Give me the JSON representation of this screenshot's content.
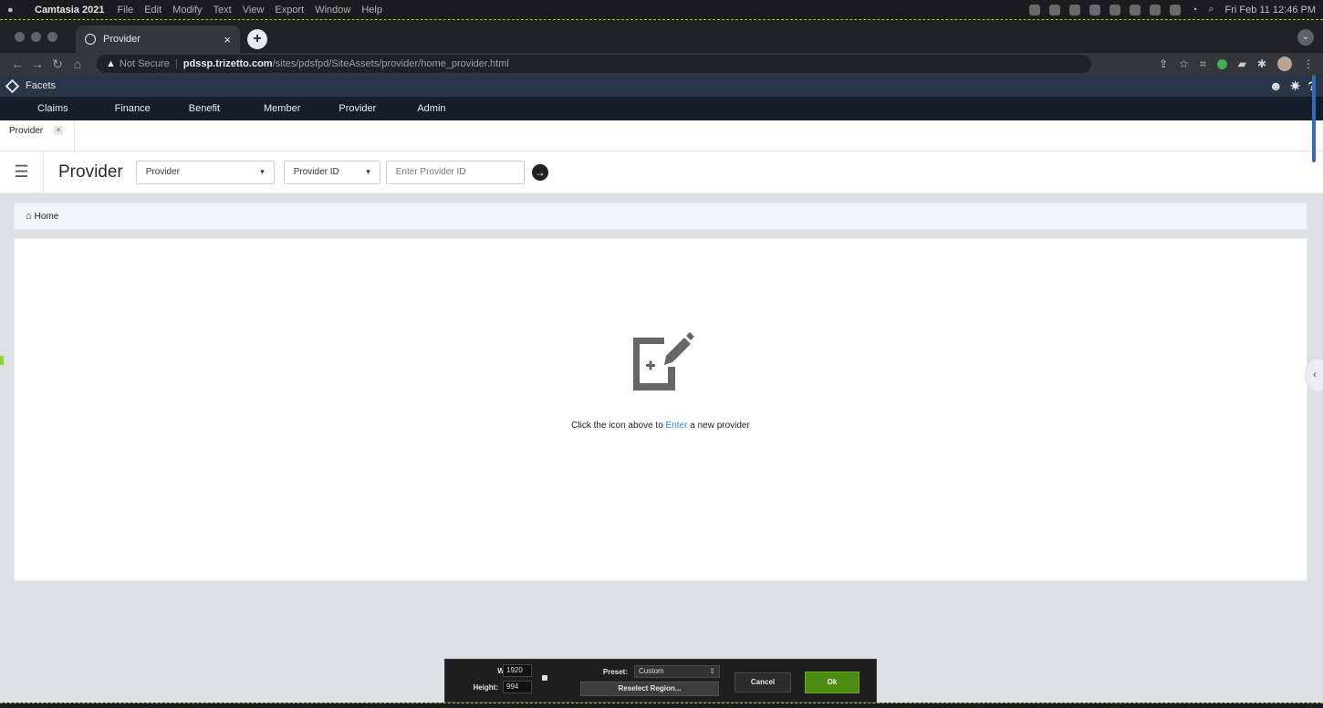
{
  "mac_menu": {
    "app_name": "Camtasia 2021",
    "menus": [
      "File",
      "Edit",
      "Modify",
      "Text",
      "View",
      "Export",
      "Window",
      "Help"
    ],
    "clock": "Fri Feb 11  12:46 PM"
  },
  "browser": {
    "tab_title": "Provider",
    "tab_close": "×",
    "new_tab": "+",
    "security_label": "Not Secure",
    "url_host": "pdssp.trizetto.com",
    "url_path": "/sites/pdsfpd/SiteAssets/provider/home_provider.html"
  },
  "app": {
    "brand": "Facets",
    "nav": [
      "Claims",
      "Finance",
      "Benefit",
      "Member",
      "Provider",
      "Admin"
    ],
    "open_tab": "Provider",
    "open_tab_close": "×"
  },
  "search": {
    "title": "Provider",
    "type_value": "Provider",
    "field_value": "Provider ID",
    "placeholder": "Enter Provider ID"
  },
  "breadcrumb": {
    "label": "Home"
  },
  "content": {
    "hint_before": "Click the icon above to ",
    "hint_link": "Enter",
    "hint_after": " a new provider"
  },
  "recorder": {
    "width_label": "Width:",
    "width_value": "1920",
    "height_label": "Height:",
    "height_value": "994",
    "preset_label": "Preset:",
    "preset_value": "Custom",
    "reselect_label": "Reselect Region...",
    "cancel_label": "Cancel",
    "ok_label": "Ok"
  },
  "colors": {
    "app_header": "#2a3548",
    "main_nav": "#151d2b",
    "link": "#1f8fd4",
    "ok_button": "#4d8d14"
  }
}
